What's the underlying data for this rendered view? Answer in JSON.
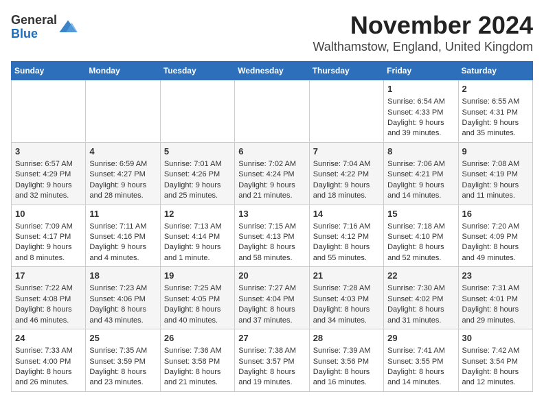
{
  "header": {
    "logo": {
      "general": "General",
      "blue": "Blue"
    },
    "title": "November 2024",
    "subtitle": "Walthamstow, England, United Kingdom"
  },
  "days_of_week": [
    "Sunday",
    "Monday",
    "Tuesday",
    "Wednesday",
    "Thursday",
    "Friday",
    "Saturday"
  ],
  "weeks": [
    {
      "days": [
        {
          "number": "",
          "content": ""
        },
        {
          "number": "",
          "content": ""
        },
        {
          "number": "",
          "content": ""
        },
        {
          "number": "",
          "content": ""
        },
        {
          "number": "",
          "content": ""
        },
        {
          "number": "1",
          "content": "Sunrise: 6:54 AM\nSunset: 4:33 PM\nDaylight: 9 hours\nand 39 minutes."
        },
        {
          "number": "2",
          "content": "Sunrise: 6:55 AM\nSunset: 4:31 PM\nDaylight: 9 hours\nand 35 minutes."
        }
      ]
    },
    {
      "days": [
        {
          "number": "3",
          "content": "Sunrise: 6:57 AM\nSunset: 4:29 PM\nDaylight: 9 hours\nand 32 minutes."
        },
        {
          "number": "4",
          "content": "Sunrise: 6:59 AM\nSunset: 4:27 PM\nDaylight: 9 hours\nand 28 minutes."
        },
        {
          "number": "5",
          "content": "Sunrise: 7:01 AM\nSunset: 4:26 PM\nDaylight: 9 hours\nand 25 minutes."
        },
        {
          "number": "6",
          "content": "Sunrise: 7:02 AM\nSunset: 4:24 PM\nDaylight: 9 hours\nand 21 minutes."
        },
        {
          "number": "7",
          "content": "Sunrise: 7:04 AM\nSunset: 4:22 PM\nDaylight: 9 hours\nand 18 minutes."
        },
        {
          "number": "8",
          "content": "Sunrise: 7:06 AM\nSunset: 4:21 PM\nDaylight: 9 hours\nand 14 minutes."
        },
        {
          "number": "9",
          "content": "Sunrise: 7:08 AM\nSunset: 4:19 PM\nDaylight: 9 hours\nand 11 minutes."
        }
      ]
    },
    {
      "days": [
        {
          "number": "10",
          "content": "Sunrise: 7:09 AM\nSunset: 4:17 PM\nDaylight: 9 hours\nand 8 minutes."
        },
        {
          "number": "11",
          "content": "Sunrise: 7:11 AM\nSunset: 4:16 PM\nDaylight: 9 hours\nand 4 minutes."
        },
        {
          "number": "12",
          "content": "Sunrise: 7:13 AM\nSunset: 4:14 PM\nDaylight: 9 hours\nand 1 minute."
        },
        {
          "number": "13",
          "content": "Sunrise: 7:15 AM\nSunset: 4:13 PM\nDaylight: 8 hours\nand 58 minutes."
        },
        {
          "number": "14",
          "content": "Sunrise: 7:16 AM\nSunset: 4:12 PM\nDaylight: 8 hours\nand 55 minutes."
        },
        {
          "number": "15",
          "content": "Sunrise: 7:18 AM\nSunset: 4:10 PM\nDaylight: 8 hours\nand 52 minutes."
        },
        {
          "number": "16",
          "content": "Sunrise: 7:20 AM\nSunset: 4:09 PM\nDaylight: 8 hours\nand 49 minutes."
        }
      ]
    },
    {
      "days": [
        {
          "number": "17",
          "content": "Sunrise: 7:22 AM\nSunset: 4:08 PM\nDaylight: 8 hours\nand 46 minutes."
        },
        {
          "number": "18",
          "content": "Sunrise: 7:23 AM\nSunset: 4:06 PM\nDaylight: 8 hours\nand 43 minutes."
        },
        {
          "number": "19",
          "content": "Sunrise: 7:25 AM\nSunset: 4:05 PM\nDaylight: 8 hours\nand 40 minutes."
        },
        {
          "number": "20",
          "content": "Sunrise: 7:27 AM\nSunset: 4:04 PM\nDaylight: 8 hours\nand 37 minutes."
        },
        {
          "number": "21",
          "content": "Sunrise: 7:28 AM\nSunset: 4:03 PM\nDaylight: 8 hours\nand 34 minutes."
        },
        {
          "number": "22",
          "content": "Sunrise: 7:30 AM\nSunset: 4:02 PM\nDaylight: 8 hours\nand 31 minutes."
        },
        {
          "number": "23",
          "content": "Sunrise: 7:31 AM\nSunset: 4:01 PM\nDaylight: 8 hours\nand 29 minutes."
        }
      ]
    },
    {
      "days": [
        {
          "number": "24",
          "content": "Sunrise: 7:33 AM\nSunset: 4:00 PM\nDaylight: 8 hours\nand 26 minutes."
        },
        {
          "number": "25",
          "content": "Sunrise: 7:35 AM\nSunset: 3:59 PM\nDaylight: 8 hours\nand 23 minutes."
        },
        {
          "number": "26",
          "content": "Sunrise: 7:36 AM\nSunset: 3:58 PM\nDaylight: 8 hours\nand 21 minutes."
        },
        {
          "number": "27",
          "content": "Sunrise: 7:38 AM\nSunset: 3:57 PM\nDaylight: 8 hours\nand 19 minutes."
        },
        {
          "number": "28",
          "content": "Sunrise: 7:39 AM\nSunset: 3:56 PM\nDaylight: 8 hours\nand 16 minutes."
        },
        {
          "number": "29",
          "content": "Sunrise: 7:41 AM\nSunset: 3:55 PM\nDaylight: 8 hours\nand 14 minutes."
        },
        {
          "number": "30",
          "content": "Sunrise: 7:42 AM\nSunset: 3:54 PM\nDaylight: 8 hours\nand 12 minutes."
        }
      ]
    }
  ]
}
